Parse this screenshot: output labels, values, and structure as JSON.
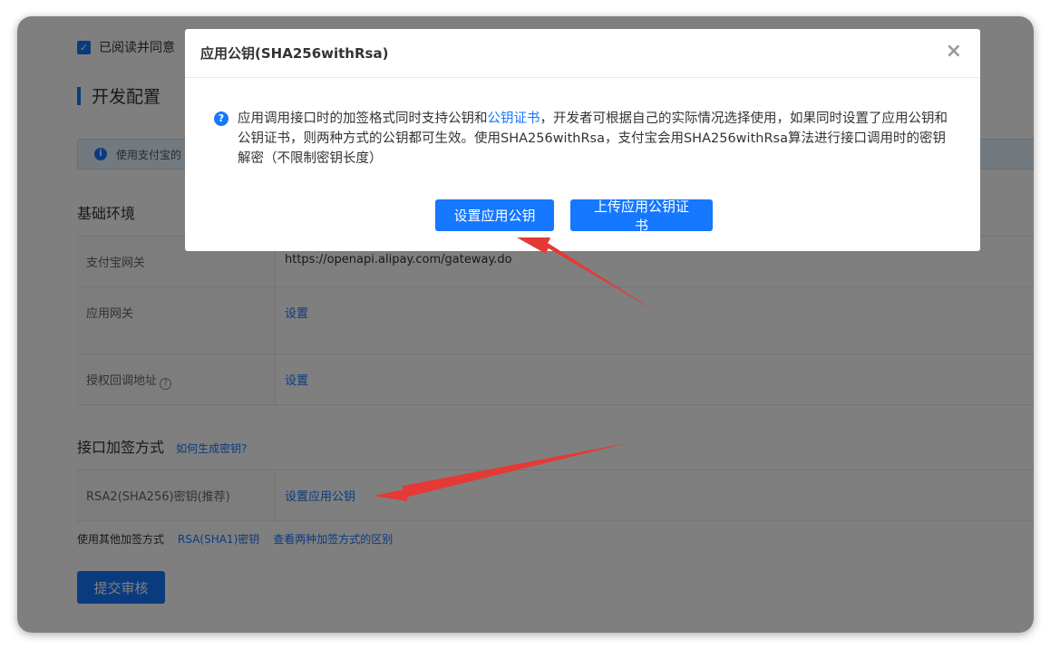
{
  "page": {
    "agree_text": "已阅读并同意",
    "section_title": "开发配置",
    "info_text": "使用支付宝的",
    "basic_env_title": "基础环境",
    "basic_env_rows": [
      {
        "label": "支付宝网关",
        "value": "https://openapi.alipay.com/gateway.do",
        "is_link": false
      },
      {
        "label": "应用网关",
        "value": "设置",
        "is_link": true
      },
      {
        "label": "授权回调地址",
        "value": "设置",
        "is_link": true,
        "help_icon": "question-icon"
      }
    ],
    "sign_title": "接口加签方式",
    "sign_help_link": "如何生成密钥?",
    "sign_rows": [
      {
        "label": "RSA2(SHA256)密钥(推荐)",
        "value": "设置应用公钥"
      }
    ],
    "other_methods_label": "使用其他加签方式",
    "other_methods_link1": "RSA(SHA1)密钥",
    "other_methods_link2": "查看两种加签方式的区别",
    "submit_label": "提交审核"
  },
  "modal": {
    "title": "应用公钥(SHA256withRsa)",
    "close_icon": "close-icon",
    "body_prefix": "应用调用接口时的加签格式同时支持公钥和",
    "body_link": "公钥证书",
    "body_suffix": "，开发者可根据自己的实际情况选择使用，如果同时设置了应用公钥和公钥证书，则两种方式的公钥都可生效。使用SHA256withRsa，支付宝会用SHA256withRsa算法进行接口调用时的密钥解密（不限制密钥长度）",
    "button_set_key": "设置应用公钥",
    "button_upload_cert": "上传应用公钥证书"
  },
  "colors": {
    "accent": "#1677ff",
    "annotation_arrow": "#e53935"
  }
}
